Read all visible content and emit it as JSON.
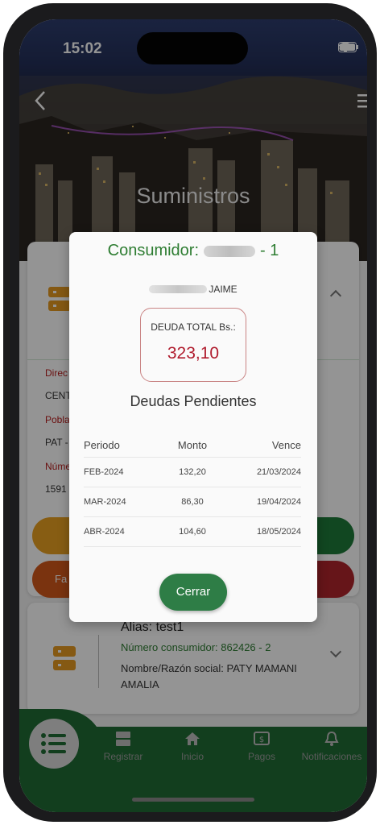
{
  "status": {
    "time": "15:02"
  },
  "header": {
    "title": "Suministros"
  },
  "background_card1": {
    "label1": "Direc",
    "value1": "CENT",
    "label2": "Pobla",
    "value2": "PAT -",
    "label3": "Núme",
    "value3": "1591",
    "button_partial": "Fa"
  },
  "background_card2": {
    "alias": "Alias: test1",
    "consumer_number": "Número consumidor: 862426 - 2",
    "name_line1": "Nombre/Razón social: PATY MAMANI",
    "name_line2": "AMALIA"
  },
  "modal": {
    "title_prefix": "Consumidor:",
    "title_suffix": "- 1",
    "name_suffix": "JAIME",
    "debt_label": "DEUDA TOTAL Bs.:",
    "debt_value": "323,10",
    "subtitle": "Deudas Pendientes",
    "columns": [
      "Periodo",
      "Monto",
      "Vence"
    ],
    "rows": [
      [
        "FEB-2024",
        "132,20",
        "21/03/2024"
      ],
      [
        "MAR-2024",
        "86,30",
        "19/04/2024"
      ],
      [
        "ABR-2024",
        "104,60",
        "18/05/2024"
      ]
    ],
    "close_label": "Cerrar"
  },
  "nav": {
    "items": [
      {
        "label": "Registrar",
        "icon": "server-icon"
      },
      {
        "label": "Inicio",
        "icon": "home-icon"
      },
      {
        "label": "Pagos",
        "icon": "payment-icon"
      },
      {
        "label": "Notificaciones",
        "icon": "bell-icon"
      }
    ],
    "fab_icon": "list-icon"
  },
  "colors": {
    "primary_green": "#2e7d32",
    "nav_green": "#1f6b34",
    "debt_red": "#b01c2e",
    "accent_orange": "#e59a22"
  }
}
